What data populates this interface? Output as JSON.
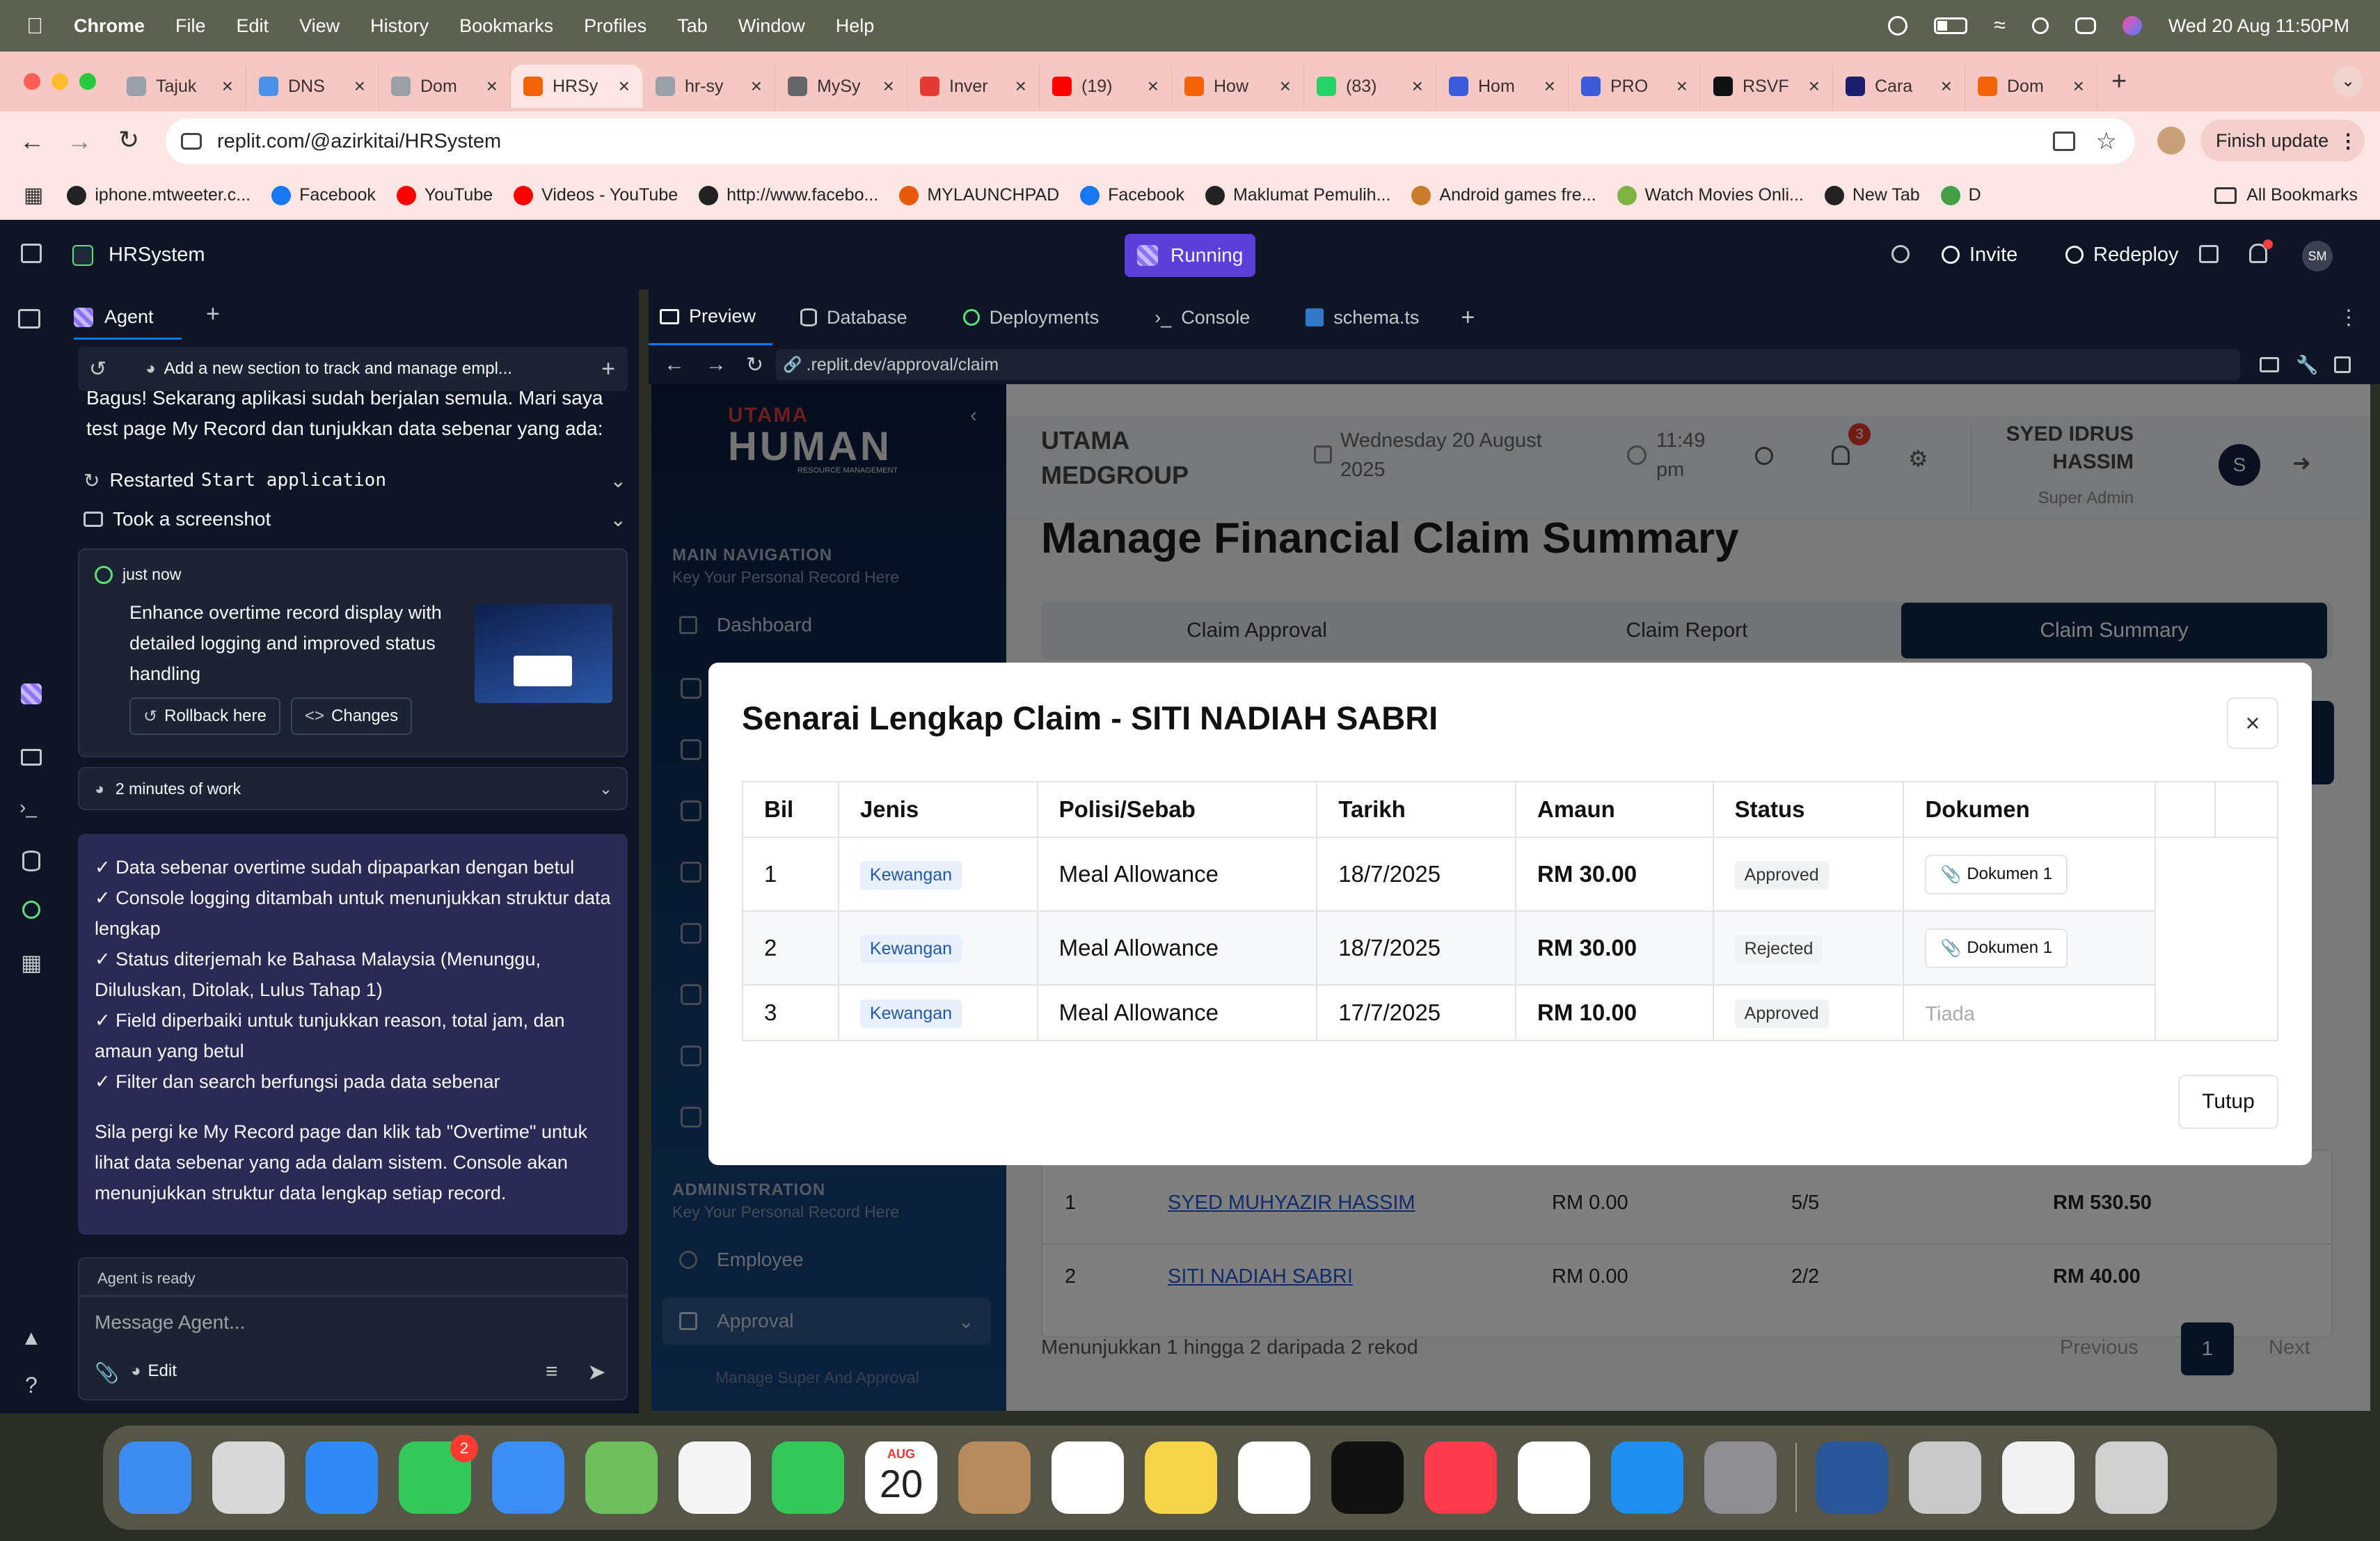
{
  "menubar": {
    "app": "Chrome",
    "items": [
      "File",
      "Edit",
      "View",
      "History",
      "Bookmarks",
      "Profiles",
      "Tab",
      "Window",
      "Help"
    ],
    "datetime": "Wed 20 Aug  11:50PM"
  },
  "tabs": [
    {
      "label": "Tajuk",
      "color": "#9aa0a6"
    },
    {
      "label": "DNS",
      "color": "#4a8fe8"
    },
    {
      "label": "Dom",
      "color": "#9aa0a6"
    },
    {
      "label": "HRSy",
      "color": "#f26207"
    },
    {
      "label": "hr-sy",
      "color": "#9aa0a6"
    },
    {
      "label": "MySy",
      "color": "#666"
    },
    {
      "label": "Inver",
      "color": "#e53935"
    },
    {
      "label": "(19)",
      "color": "#ff0000"
    },
    {
      "label": "How",
      "color": "#f26207"
    },
    {
      "label": "(83)",
      "color": "#25d366"
    },
    {
      "label": "Hom",
      "color": "#3b5bdb"
    },
    {
      "label": "PRO",
      "color": "#3b5bdb"
    },
    {
      "label": "RSVF",
      "color": "#111"
    },
    {
      "label": "Cara",
      "color": "#1b1f6b"
    },
    {
      "label": "Dom",
      "color": "#f26207"
    }
  ],
  "toolbar": {
    "url": "replit.com/@azirkitai/HRSystem",
    "finish_update": "Finish update"
  },
  "bookmarks": [
    {
      "label": "iphone.mtweeter.c...",
      "color": "#222"
    },
    {
      "label": "Facebook",
      "color": "#1877f2"
    },
    {
      "label": "YouTube",
      "color": "#ff0000"
    },
    {
      "label": "Videos - YouTube",
      "color": "#ff0000"
    },
    {
      "label": "http://www.facebo...",
      "color": "#222"
    },
    {
      "label": "MYLAUNCHPAD",
      "color": "#e8590c"
    },
    {
      "label": "Facebook",
      "color": "#1877f2"
    },
    {
      "label": "Maklumat Pemulih...",
      "color": "#222"
    },
    {
      "label": "Android games fre...",
      "color": "#c97b2a"
    },
    {
      "label": "Watch Movies Onli...",
      "color": "#7cb342"
    },
    {
      "label": "New Tab",
      "color": "#222"
    },
    {
      "label": "D",
      "color": "#43a047"
    }
  ],
  "all_bookmarks": "All Bookmarks",
  "replit": {
    "project": "HRSystem",
    "status": "Running",
    "invite": "Invite",
    "redeploy": "Redeploy",
    "avatar": "SM"
  },
  "agent": {
    "tab": "Agent",
    "thread_title": "Add a new section to track and manage empl...",
    "intro": "Bagus! Sekarang aplikasi sudah berjalan semula. Mari saya test page My Record dan tunjukkan data sebenar yang ada:",
    "action1_prefix": "Restarted",
    "action1_code": "Start application",
    "action2": "Took a screenshot",
    "checkpoint_time": "just now",
    "checkpoint_text": "Enhance overtime record display with detailed logging and improved status handling",
    "rollback": "Rollback here",
    "changes": "Changes",
    "work_time": "2 minutes of work",
    "summary_lines": [
      "✓ Data sebenar overtime sudah dipaparkan dengan betul",
      "✓ Console logging ditambah untuk menunjukkan struktur data lengkap",
      "✓ Status diterjemah ke Bahasa Malaysia (Menunggu, Diluluskan, Ditolak, Lulus Tahap 1)",
      "✓ Field diperbaiki untuk tunjukkan reason, total jam, dan amaun yang betul",
      "✓ Filter dan search berfungsi pada data sebenar"
    ],
    "summary_footer": "Sila pergi ke My Record page dan klik tab \"Overtime\" untuk lihat data sebenar yang ada dalam sistem. Console akan menunjukkan struktur data lengkap setiap record.",
    "ready": "Agent is ready",
    "placeholder": "Message Agent...",
    "edit": "Edit"
  },
  "panel_tabs": [
    "Preview",
    "Database",
    "Deployments",
    "Console",
    "schema.ts"
  ],
  "preview_url": ".replit.dev/approval/claim",
  "app": {
    "logo_top": "UTAMA",
    "logo_main": "HUMAN",
    "logo_sub": "RESOURCE MANAGEMENT",
    "nav_title": "MAIN NAVIGATION",
    "nav_sub": "Key Your Personal Record Here",
    "nav_dashboard": "Dashboard",
    "admin_title": "ADMINISTRATION",
    "admin_sub": "Key Your Personal Record Here",
    "nav_employee": "Employee",
    "nav_approval": "Approval",
    "nav_manage": "Manage Super And Approval",
    "company": "UTAMA MEDGROUP",
    "date": "Wednesday 20 August 2025",
    "time": "11:49 pm",
    "notif_count": "3",
    "user_name": "SYED IDRUS HASSIM",
    "user_role": "Super Admin",
    "user_initial": "S",
    "page_title": "Manage Financial Claim Summary",
    "tabs": [
      "Claim Approval",
      "Claim Report",
      "Claim Summary"
    ],
    "bg_rows": [
      {
        "no": "1",
        "name": "SYED MUHYAZIR HASSIM",
        "amount": "RM 0.00",
        "count": "5/5",
        "total": "RM 530.50"
      },
      {
        "no": "2",
        "name": "SITI NADIAH SABRI",
        "amount": "RM 0.00",
        "count": "2/2",
        "total": "RM 40.00"
      }
    ],
    "pagination_info": "Menunjukkan 1 hingga 2 daripada 2 rekod",
    "previous": "Previous",
    "page": "1",
    "next": "Next"
  },
  "modal": {
    "title": "Senarai Lengkap Claim - SITI NADIAH SABRI",
    "headers": [
      "Bil",
      "Jenis",
      "Polisi/Sebab",
      "Tarikh",
      "Amaun",
      "Status",
      "Dokumen"
    ],
    "rows": [
      {
        "bil": "1",
        "jenis": "Kewangan",
        "polisi": "Meal Allowance",
        "tarikh": "18/7/2025",
        "amaun": "RM 30.00",
        "status": "Approved",
        "dokumen": "Dokumen 1"
      },
      {
        "bil": "2",
        "jenis": "Kewangan",
        "polisi": "Meal Allowance",
        "tarikh": "18/7/2025",
        "amaun": "RM 30.00",
        "status": "Rejected",
        "dokumen": "Dokumen 1"
      },
      {
        "bil": "3",
        "jenis": "Kewangan",
        "polisi": "Meal Allowance",
        "tarikh": "17/7/2025",
        "amaun": "RM 10.00",
        "status": "Approved",
        "dokumen": "Tiada"
      }
    ],
    "close": "Tutup"
  },
  "dock": {
    "calendar_month": "AUG",
    "calendar_day": "20",
    "messages_badge": "2",
    "apps": [
      {
        "name": "finder-icon",
        "color": "#3d8cf0"
      },
      {
        "name": "launchpad-icon",
        "color": "#d9d9d9"
      },
      {
        "name": "safari-icon",
        "color": "#2f8af5"
      },
      {
        "name": "messages-icon",
        "color": "#34c759"
      },
      {
        "name": "mail-icon",
        "color": "#3a8ef6"
      },
      {
        "name": "maps-icon",
        "color": "#6fbf5f"
      },
      {
        "name": "photos-icon",
        "color": "#f5f5f5"
      },
      {
        "name": "facetime-icon",
        "color": "#34c759"
      },
      {
        "name": "calendar-icon",
        "color": "#ffffff"
      },
      {
        "name": "contacts-icon",
        "color": "#b58a5c"
      },
      {
        "name": "reminders-icon",
        "color": "#ffffff"
      },
      {
        "name": "notes-icon",
        "color": "#f7d548"
      },
      {
        "name": "freeform-icon",
        "color": "#ffffff"
      },
      {
        "name": "appletv-icon",
        "color": "#111111"
      },
      {
        "name": "music-icon",
        "color": "#fa3b4c"
      },
      {
        "name": "chrome-icon",
        "color": "#ffffff"
      },
      {
        "name": "appstore-icon",
        "color": "#1f8ef1"
      },
      {
        "name": "settings-icon",
        "color": "#8e8e93"
      },
      {
        "name": "word-icon",
        "color": "#2b579a"
      },
      {
        "name": "iphone-mirroring-icon",
        "color": "#c9c9c9"
      },
      {
        "name": "document-icon",
        "color": "#f2f2f2"
      },
      {
        "name": "trash-icon",
        "color": "#d0d0d0"
      }
    ]
  }
}
